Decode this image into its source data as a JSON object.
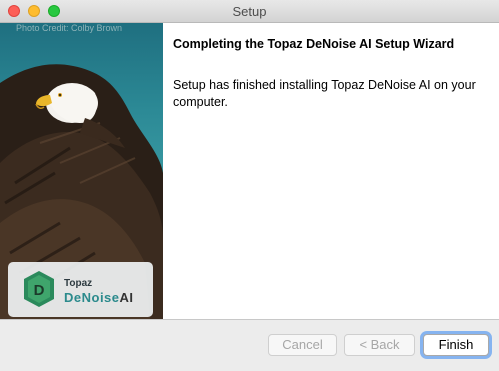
{
  "window": {
    "title": "Setup"
  },
  "banner": {
    "photo_credit": "Photo Credit: Colby Brown",
    "logo": {
      "brand": "Topaz",
      "product_main": "DeNoise",
      "product_suffix": "AI"
    }
  },
  "content": {
    "heading": "Completing the Topaz DeNoise AI Setup Wizard",
    "body": "Setup has finished installing Topaz DeNoise AI on your computer."
  },
  "buttons": {
    "cancel": "Cancel",
    "back": "< Back",
    "finish": "Finish"
  },
  "colors": {
    "accent": "#86b4f0",
    "brand_teal": "#2b8a8c"
  }
}
